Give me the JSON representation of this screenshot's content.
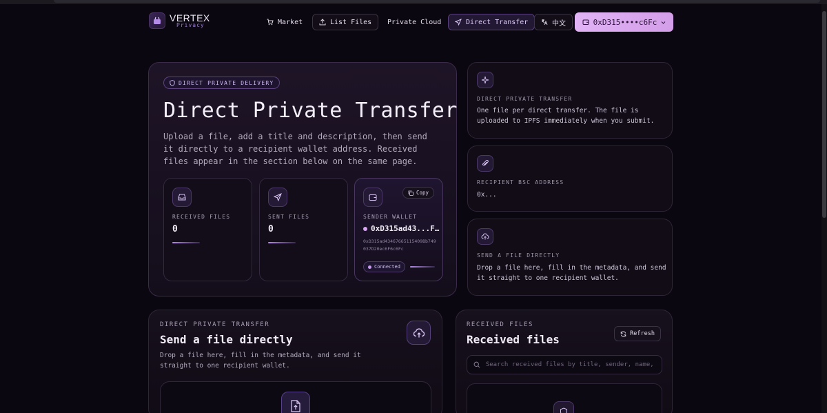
{
  "nav": {
    "logo_title": "VERTEX",
    "logo_sub": "Privacy",
    "items": [
      {
        "label": "Market",
        "icon": "cart-icon"
      },
      {
        "label": "List Files",
        "icon": "upload-icon"
      },
      {
        "label": "Private Cloud"
      },
      {
        "label": "Direct Transfer",
        "icon": "send-icon"
      },
      {
        "label": "中文",
        "icon": "translate-icon"
      }
    ],
    "wallet_label": "0xD315••••c6Fc"
  },
  "hero": {
    "badge": "DIRECT PRIVATE DELIVERY",
    "title": "Direct Private Transfer",
    "description": "Upload a file, add a title and description, then send it directly to a recipient wallet address. Received files appear in the section below on the same page.",
    "stats": {
      "received": {
        "label": "RECEIVED FILES",
        "value": "0"
      },
      "sent": {
        "label": "SENT FILES",
        "value": "0"
      }
    },
    "sender": {
      "label": "SENDER WALLET",
      "copy_label": "Copy",
      "address_short": "0xD315ad43...F…",
      "address_full": "0xD315ad43467665115409Bb749037D20ec6F6c6Fc",
      "status": "Connected"
    }
  },
  "side_cards": [
    {
      "label": "DIRECT PRIVATE TRANSFER",
      "text": "One file per direct transfer. The file is uploaded to IPFS immediately when you submit.",
      "icon": "sparkle-icon"
    },
    {
      "label": "RECIPIENT BSC ADDRESS",
      "text": "0x...",
      "icon": "paperclip-icon"
    },
    {
      "label": "SEND A FILE DIRECTLY",
      "text": "Drop a file here, fill in the metadata, and send it straight to one recipient wallet.",
      "icon": "cloud-upload-icon"
    }
  ],
  "send_panel": {
    "eyebrow": "DIRECT PRIVATE TRANSFER",
    "title": "Send a file directly",
    "description": "Drop a file here, fill in the metadata, and send it straight to one recipient wallet."
  },
  "received_panel": {
    "eyebrow": "RECEIVED FILES",
    "title": "Received files",
    "refresh_label": "Refresh",
    "search_placeholder": "Search received files by title, sender, name, or"
  },
  "colors": {
    "accent": "#d9a6f5",
    "background": "#0b0710"
  }
}
